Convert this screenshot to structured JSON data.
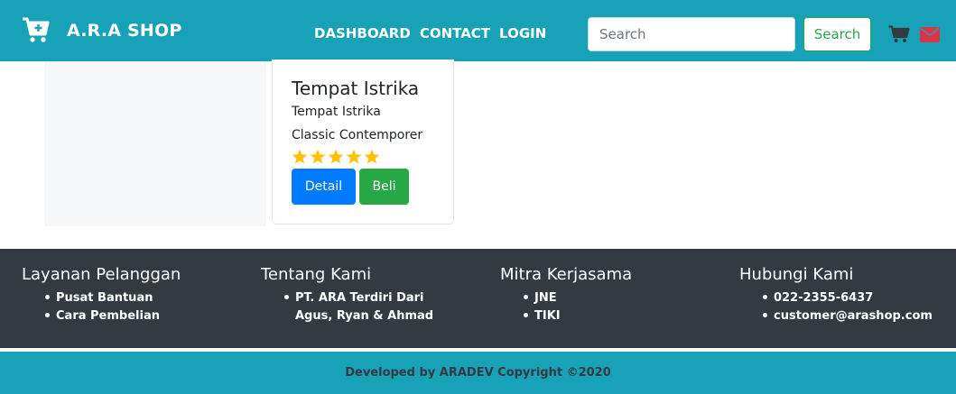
{
  "navbar": {
    "brand": "A.R.A SHOP",
    "brand_icon": "cart-plus-icon",
    "links": [
      "DASHBOARD",
      "CONTACT",
      "LOGIN"
    ],
    "search": {
      "placeholder": "Search",
      "value": ""
    },
    "search_button": "Search",
    "icons": [
      "cart-icon",
      "envelope-icon"
    ],
    "color": "#17a2b8"
  },
  "product": {
    "title": "Tempat Istrika",
    "subtitle": "Tempat Istrika",
    "description": "Classic Contemporer",
    "rating": 5,
    "rating_max": 5,
    "detail_label": "Detail",
    "buy_label": "Beli"
  },
  "footer": {
    "columns": [
      {
        "title": "Layanan Pelanggan",
        "items": [
          "Pusat Bantuan",
          "Cara Pembelian"
        ]
      },
      {
        "title": "Tentang Kami",
        "items": [
          "PT. ARA Terdiri Dari",
          "Agus, Ryan & Ahmad"
        ]
      },
      {
        "title": "Mitra Kerjasama",
        "items": [
          "JNE",
          "TIKI"
        ]
      },
      {
        "title": "Hubungi Kami",
        "items": [
          "022-2355-6437",
          "customer@arashop.com"
        ]
      }
    ],
    "copyright": "Developed by ARADEV Copyright ©2020"
  },
  "colors": {
    "primary": "#007bff",
    "success": "#28a745",
    "info": "#17a2b8",
    "dark": "#343a40",
    "star": "#ffc107",
    "mail": "#dc3545"
  }
}
